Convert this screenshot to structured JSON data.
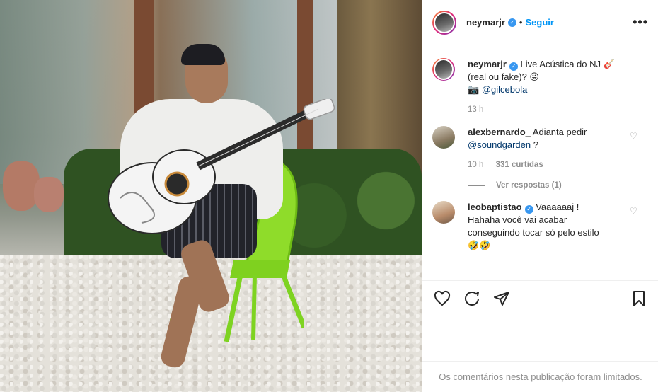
{
  "header": {
    "username": "neymarjr",
    "follow_label": "Seguir",
    "separator": "•",
    "more_icon": "more-horizontal-icon"
  },
  "caption": {
    "username": "neymarjr",
    "text_line1": "Live Acústica do NJ 🎸",
    "text_line2": "(real ou fake)? 😜",
    "camera_emoji": "📷",
    "mention": "@gilcebola",
    "time": "13 h"
  },
  "comments": [
    {
      "username": "alexbernardo_",
      "text": "Adianta pedir",
      "mention": "@soundgarden",
      "text_after": " ?",
      "time": "10 h",
      "likes": "331 curtidas",
      "replies_label": "Ver respostas (1)"
    },
    {
      "username": "leobaptistao",
      "text_first": "Vaaaaaaj !",
      "text_rest": "Hahaha você vai acabar conseguindo tocar só pelo estilo",
      "emojis": "🤣🤣"
    }
  ],
  "actions": {
    "like_icon": "heart-icon",
    "comment_icon": "comment-icon",
    "share_icon": "share-icon",
    "save_icon": "bookmark-icon"
  },
  "footer": {
    "limited_text": "Os comentários nesta publicação foram limitados."
  },
  "colors": {
    "verified": "#3897f0",
    "follow": "#0095f6",
    "muted": "#8e8e8e",
    "chair": "#7ed321"
  }
}
